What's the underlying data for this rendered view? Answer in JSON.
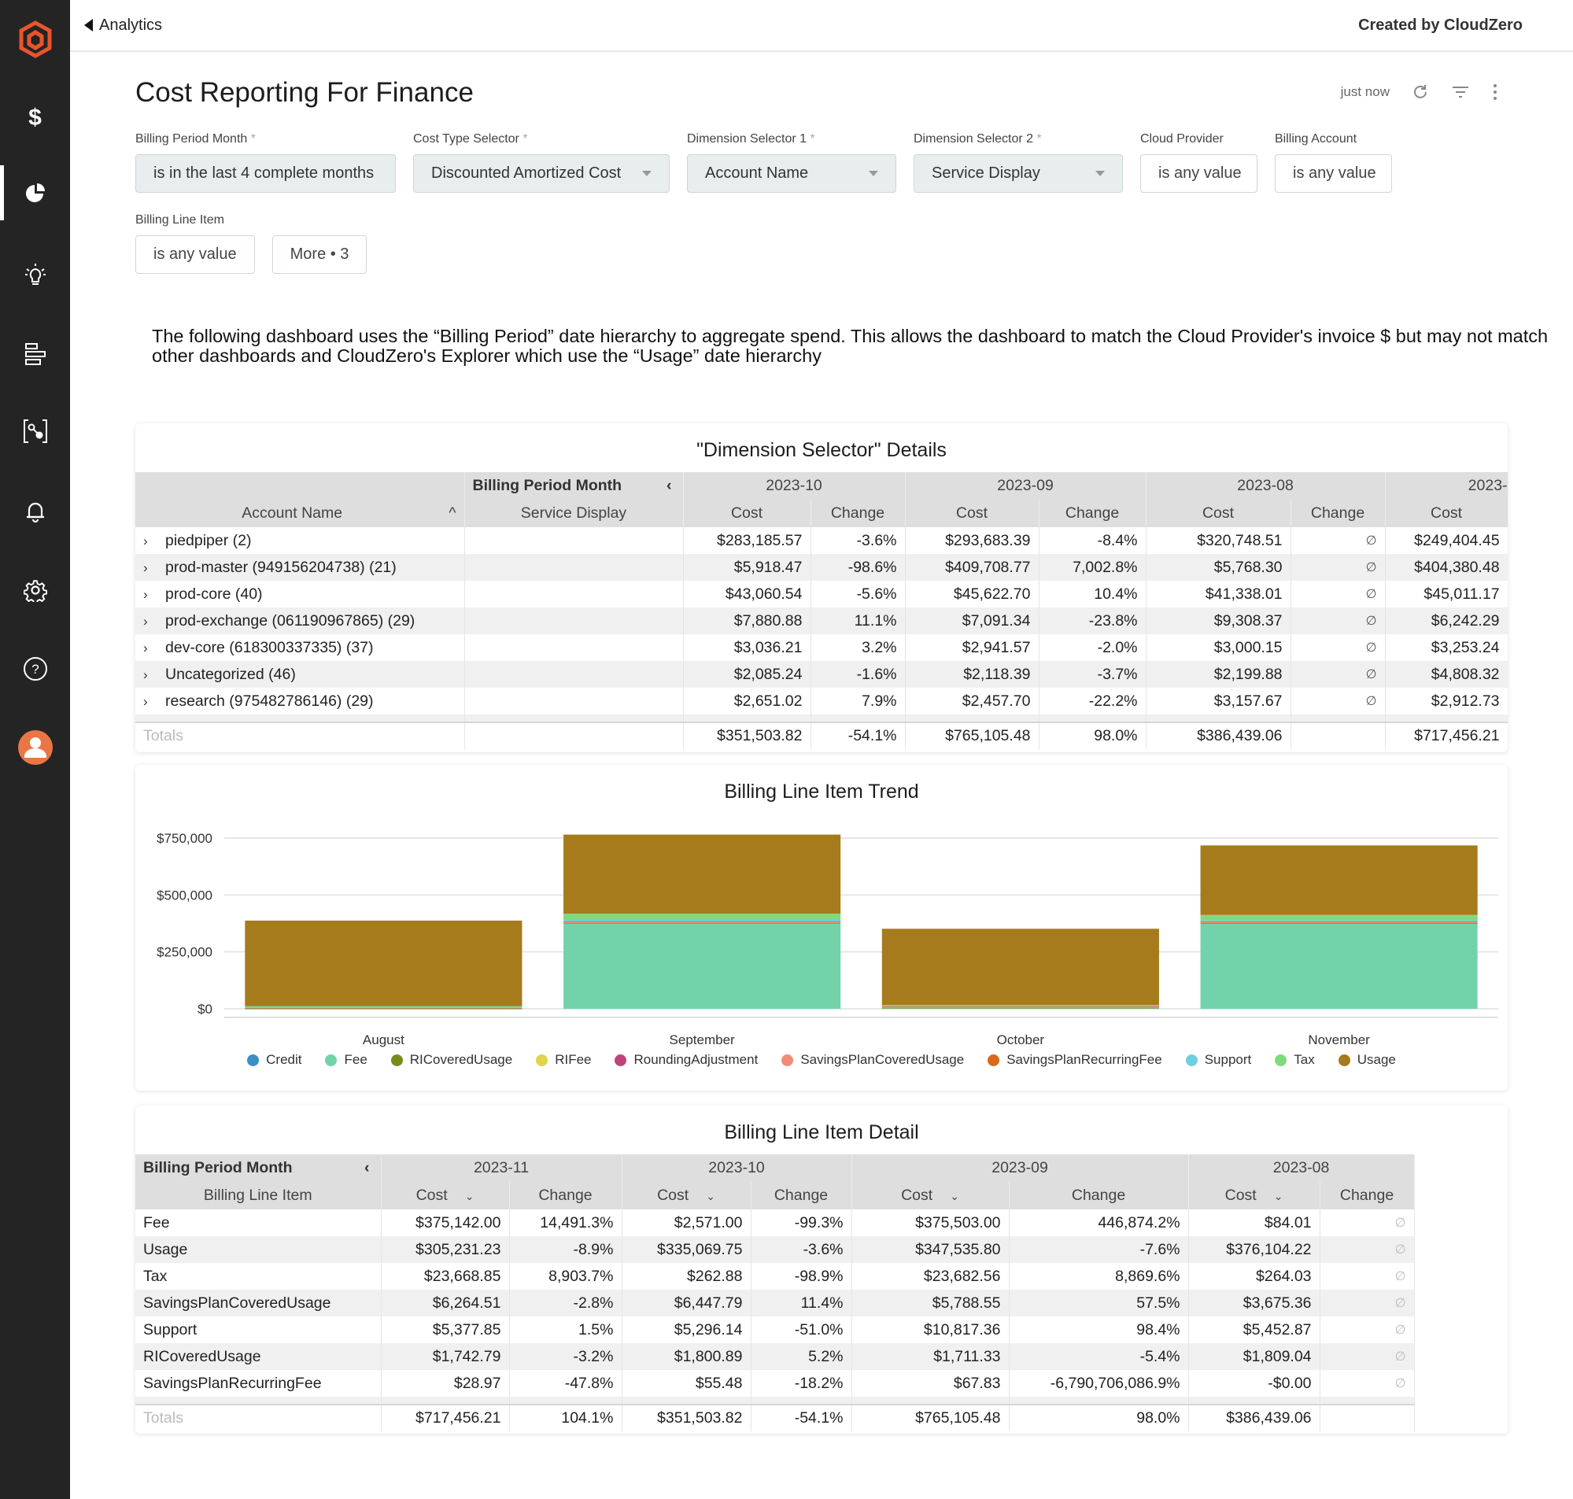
{
  "topbar": {
    "back_label": "Analytics",
    "creator": "Created by CloudZero"
  },
  "sidebar": {
    "items": [
      {
        "name": "cost-icon",
        "glyph": "$"
      },
      {
        "name": "analytics-icon"
      },
      {
        "name": "insights-icon"
      },
      {
        "name": "dimensions-icon"
      },
      {
        "name": "explorer-icon"
      },
      {
        "name": "alerts-icon"
      },
      {
        "name": "settings-icon"
      },
      {
        "name": "help-icon"
      },
      {
        "name": "user-avatar-icon"
      }
    ]
  },
  "page": {
    "title": "Cost Reporting For Finance",
    "refresh_status": "just now"
  },
  "filters": [
    {
      "label": "Billing Period Month",
      "required": "*",
      "value": "is in the last 4 complete months",
      "type": "text"
    },
    {
      "label": "Cost Type Selector",
      "required": "*",
      "value": "Discounted Amortized Cost",
      "type": "select"
    },
    {
      "label": "Dimension Selector 1",
      "required": "*",
      "value": "Account Name",
      "type": "select"
    },
    {
      "label": "Dimension Selector 2",
      "required": "*",
      "value": "Service Display",
      "type": "select"
    },
    {
      "label": "Cloud Provider",
      "required": "",
      "value": "is any value",
      "type": "plain"
    },
    {
      "label": "Billing Account",
      "required": "",
      "value": "is any value",
      "type": "plain"
    }
  ],
  "filters_row2": {
    "label": "Billing Line Item",
    "value": "is any value",
    "more": "More • 3"
  },
  "description": "The following dashboard uses the “Billing Period” date hierarchy to aggregate spend.  This allows the dashboard to match the Cloud Provider's invoice $ but may not match other dashboards and CloudZero's Explorer which use the “Usage” date hierarchy",
  "dim_table": {
    "title": "\"Dimension Selector\" Details",
    "pivot_label": "Billing Period Month",
    "col1": "Account Name",
    "col2": "Service Display",
    "months": [
      "2023-10",
      "2023-09",
      "2023-08",
      "2023-"
    ],
    "cost_label": "Cost",
    "change_label": "Change",
    "rows": [
      {
        "name": "piedpiper  (2)",
        "v": [
          "$283,185.57",
          "-3.6%",
          "$293,683.39",
          "-8.4%",
          "$320,748.51",
          "∅",
          "$249,404.45"
        ]
      },
      {
        "name": "prod-master (949156204738)  (21)",
        "v": [
          "$5,918.47",
          "-98.6%",
          "$409,708.77",
          "7,002.8%",
          "$5,768.30",
          "∅",
          "$404,380.48"
        ]
      },
      {
        "name": "prod-core  (40)",
        "v": [
          "$43,060.54",
          "-5.6%",
          "$45,622.70",
          "10.4%",
          "$41,338.01",
          "∅",
          "$45,011.17"
        ]
      },
      {
        "name": "prod-exchange (061190967865)  (29)",
        "v": [
          "$7,880.88",
          "11.1%",
          "$7,091.34",
          "-23.8%",
          "$9,308.37",
          "∅",
          "$6,242.29"
        ]
      },
      {
        "name": "dev-core (618300337335)  (37)",
        "v": [
          "$3,036.21",
          "3.2%",
          "$2,941.57",
          "-2.0%",
          "$3,000.15",
          "∅",
          "$3,253.24"
        ]
      },
      {
        "name": "Uncategorized  (46)",
        "v": [
          "$2,085.24",
          "-1.6%",
          "$2,118.39",
          "-3.7%",
          "$2,199.88",
          "∅",
          "$4,808.32"
        ]
      },
      {
        "name": "research (975482786146)  (29)",
        "v": [
          "$2,651.02",
          "7.9%",
          "$2,457.70",
          "-22.2%",
          "$3,157.67",
          "∅",
          "$2,912.73"
        ]
      }
    ],
    "totals_label": "Totals",
    "totals": [
      "$351,503.82",
      "-54.1%",
      "$765,105.48",
      "98.0%",
      "$386,439.06",
      "",
      "$717,456.21"
    ]
  },
  "chart_data": {
    "type": "bar",
    "stacked": true,
    "title": "Billing Line Item Trend",
    "categories": [
      "August",
      "September",
      "October",
      "November"
    ],
    "ylim": [
      0,
      750000
    ],
    "yticks": [
      0,
      250000,
      500000,
      750000
    ],
    "ytick_labels": [
      "$0",
      "$250,000",
      "$500,000",
      "$750,000"
    ],
    "grid": true,
    "legend_position": "bottom",
    "series": [
      {
        "name": "Credit",
        "color": "#3b8fc4",
        "values": [
          0,
          0,
          0,
          0
        ]
      },
      {
        "name": "Fee",
        "color": "#72d3aa",
        "values": [
          84.01,
          375503.0,
          2571.0,
          375142.0
        ]
      },
      {
        "name": "RICoveredUsage",
        "color": "#7a8b1e",
        "values": [
          1809.04,
          1711.33,
          1800.89,
          1742.79
        ]
      },
      {
        "name": "RIFee",
        "color": "#e2d24e",
        "values": [
          0,
          0,
          0,
          0
        ]
      },
      {
        "name": "RoundingAdjustment",
        "color": "#c0437a",
        "values": [
          0,
          0,
          0,
          0
        ]
      },
      {
        "name": "SavingsPlanCoveredUsage",
        "color": "#f28b78",
        "values": [
          3675.36,
          5788.55,
          6447.79,
          6264.51
        ]
      },
      {
        "name": "SavingsPlanRecurringFee",
        "color": "#d86a1e",
        "values": [
          0,
          67.83,
          55.48,
          28.97
        ]
      },
      {
        "name": "Support",
        "color": "#6ecfdf",
        "values": [
          5452.87,
          10817.36,
          5296.14,
          5377.85
        ]
      },
      {
        "name": "Tax",
        "color": "#7fdb7a",
        "values": [
          264.03,
          23682.56,
          262.88,
          23668.85
        ]
      },
      {
        "name": "Usage",
        "color": "#a57b1c",
        "values": [
          376104.22,
          347535.8,
          335069.75,
          305231.23
        ]
      }
    ]
  },
  "bli_table": {
    "title": "Billing Line Item Detail",
    "pivot_label": "Billing Period Month",
    "col1": "Billing Line Item",
    "months": [
      "2023-11",
      "2023-10",
      "2023-09",
      "2023-08"
    ],
    "cost_label": "Cost",
    "change_label": "Change",
    "rows": [
      {
        "name": "Fee",
        "v": [
          "$375,142.00",
          "14,491.3%",
          "$2,571.00",
          "-99.3%",
          "$375,503.00",
          "446,874.2%",
          "$84.01",
          "∅"
        ]
      },
      {
        "name": "Usage",
        "v": [
          "$305,231.23",
          "-8.9%",
          "$335,069.75",
          "-3.6%",
          "$347,535.80",
          "-7.6%",
          "$376,104.22",
          "∅"
        ]
      },
      {
        "name": "Tax",
        "v": [
          "$23,668.85",
          "8,903.7%",
          "$262.88",
          "-98.9%",
          "$23,682.56",
          "8,869.6%",
          "$264.03",
          "∅"
        ]
      },
      {
        "name": "SavingsPlanCoveredUsage",
        "v": [
          "$6,264.51",
          "-2.8%",
          "$6,447.79",
          "11.4%",
          "$5,788.55",
          "57.5%",
          "$3,675.36",
          "∅"
        ]
      },
      {
        "name": "Support",
        "v": [
          "$5,377.85",
          "1.5%",
          "$5,296.14",
          "-51.0%",
          "$10,817.36",
          "98.4%",
          "$5,452.87",
          "∅"
        ]
      },
      {
        "name": "RICoveredUsage",
        "v": [
          "$1,742.79",
          "-3.2%",
          "$1,800.89",
          "5.2%",
          "$1,711.33",
          "-5.4%",
          "$1,809.04",
          "∅"
        ]
      },
      {
        "name": "SavingsPlanRecurringFee",
        "v": [
          "$28.97",
          "-47.8%",
          "$55.48",
          "-18.2%",
          "$67.83",
          "-6,790,706,086.9%",
          "-$0.00",
          "∅"
        ]
      }
    ],
    "totals_label": "Totals",
    "totals": [
      "$717,456.21",
      "104.1%",
      "$351,503.82",
      "-54.1%",
      "$765,105.48",
      "98.0%",
      "$386,439.06",
      ""
    ]
  }
}
